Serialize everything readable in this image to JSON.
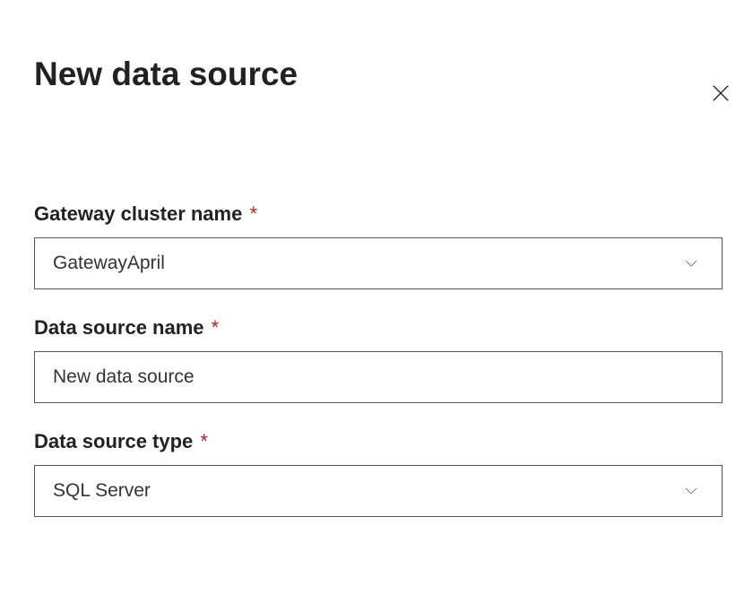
{
  "header": {
    "title": "New data source"
  },
  "form": {
    "gateway_cluster": {
      "label": "Gateway cluster name",
      "required": "*",
      "value": "GatewayApril"
    },
    "data_source_name": {
      "label": "Data source name",
      "required": "*",
      "value": "New data source"
    },
    "data_source_type": {
      "label": "Data source type",
      "required": "*",
      "value": "SQL Server"
    }
  }
}
